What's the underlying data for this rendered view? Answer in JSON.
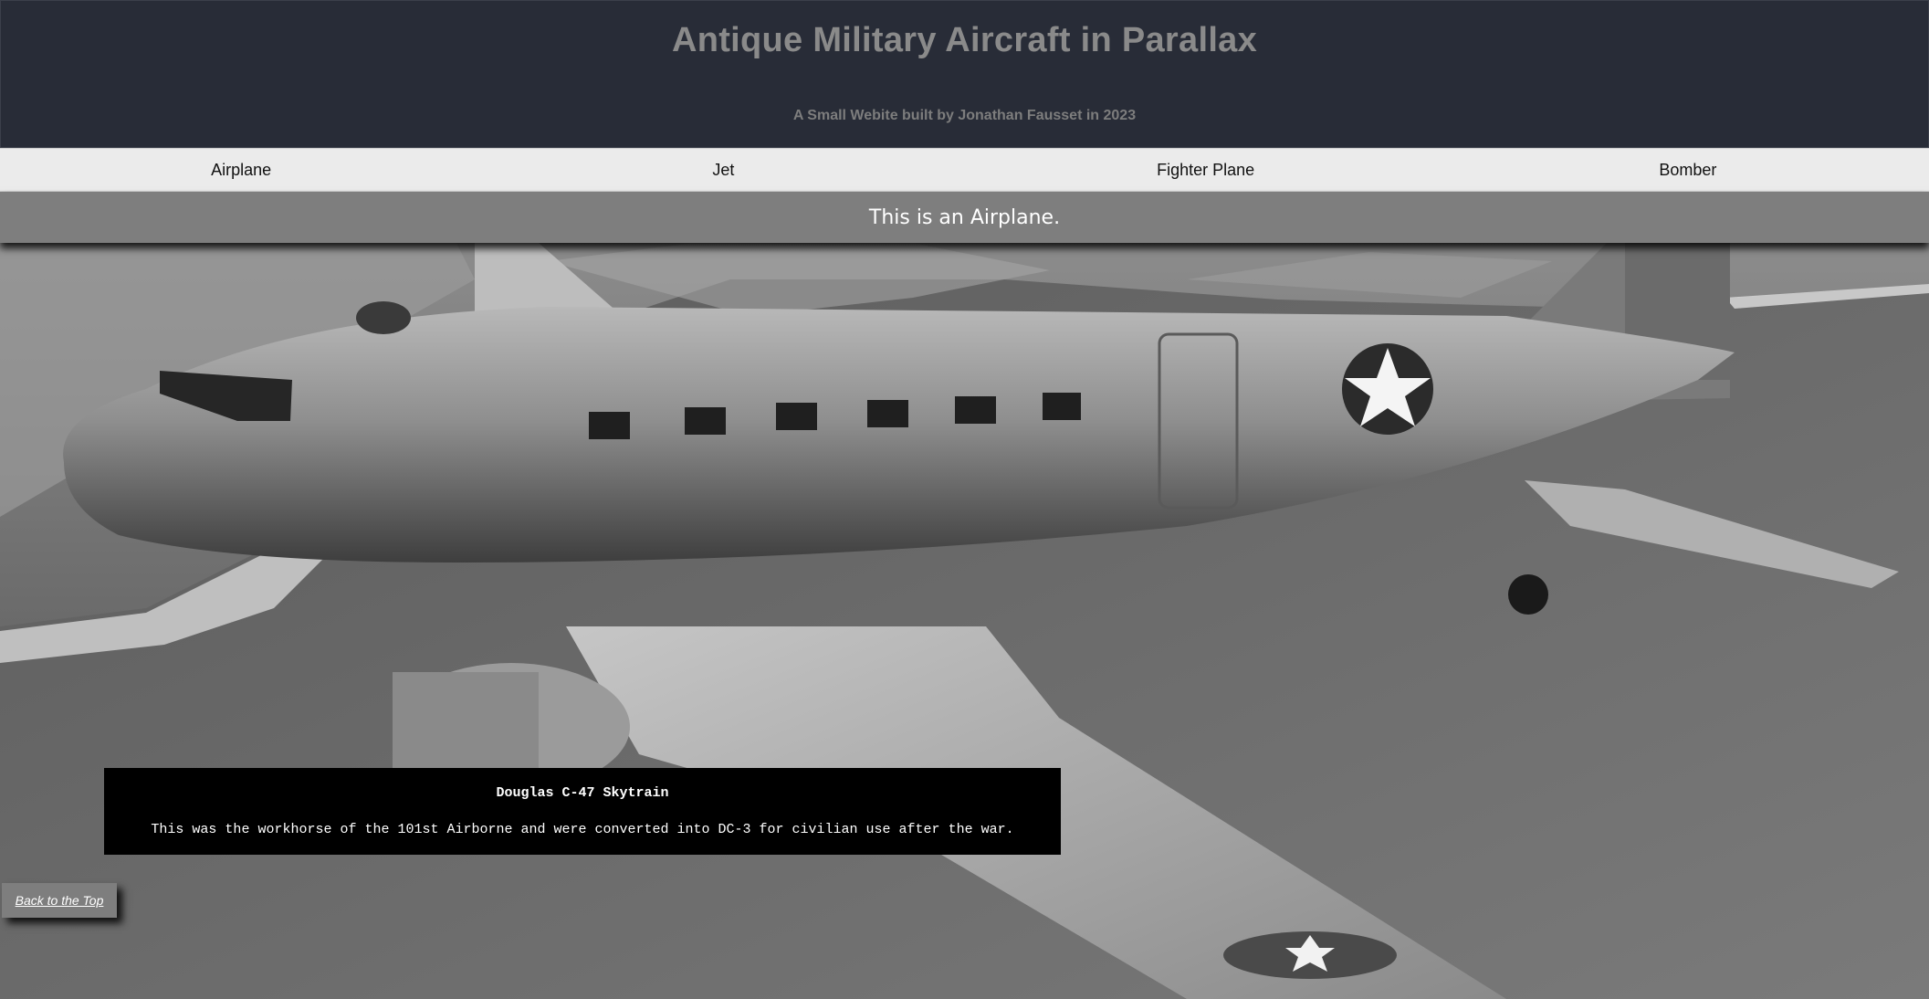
{
  "header": {
    "title": "Antique Military Aircraft in Parallax",
    "subtitle": "A Small Webite built by Jonathan Fausset in 2023"
  },
  "nav": {
    "items": [
      {
        "label": "Airplane"
      },
      {
        "label": "Jet"
      },
      {
        "label": "Fighter Plane"
      },
      {
        "label": "Bomber"
      }
    ]
  },
  "section": {
    "heading": "This is an Airplane."
  },
  "photo": {
    "subject": "c47-skytrain-photo"
  },
  "caption": {
    "title": "Douglas C-47 Skytrain",
    "body": "This was the workhorse of the 101st Airborne and were converted into DC-3 for civilian use after the war."
  },
  "back_to_top": {
    "label": "Back to the Top"
  },
  "colors": {
    "header_bg": "#282c37",
    "nav_bg": "#ebebeb",
    "section_bg": "#7e7e7e",
    "caption_bg": "#000000"
  }
}
